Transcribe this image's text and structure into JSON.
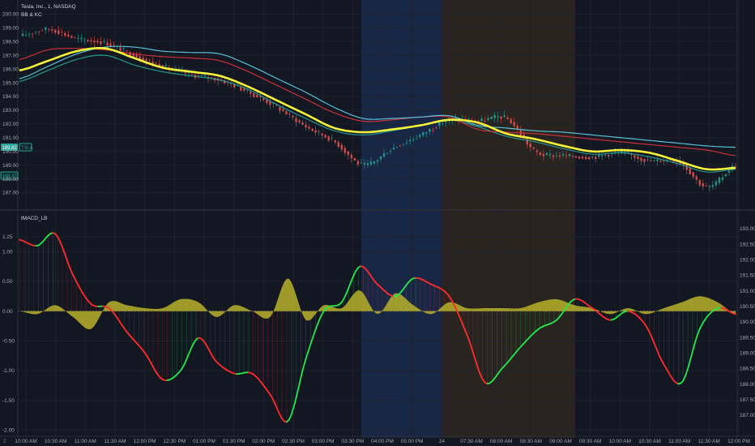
{
  "header": {
    "symbol_title": "Tesla, Inc., 1, NASDAQ",
    "indicator_1": "BB & KC",
    "indicator_2": "tMACD_LB",
    "corner_label": "Z"
  },
  "price_badges": {
    "last_price": "189.82",
    "ticker": "TSLA",
    "secondary": "188.37"
  },
  "colors": {
    "background": "#131722",
    "grid": "#1e222d",
    "session_blue": "#1b2a4d",
    "session_brown": "#2c2620",
    "kc_yellow": "#f5f23a",
    "bb_cyan": "#5cc8e0",
    "kc_red": "#d2323c",
    "candle_up": "#26a69a",
    "candle_down": "#ef5350",
    "macd_up": "#22e84a",
    "macd_down": "#ff2b2b",
    "hist_olive": "#b7b02a"
  },
  "chart_data": [
    {
      "type": "line",
      "title": "Tesla, Inc., 1, NASDAQ",
      "subtitle": "BB & KC",
      "ylim": [
        186.5,
        200.2
      ],
      "yticks": [
        "200.00",
        "199.00",
        "198.00",
        "197.00",
        "196.00",
        "195.00",
        "194.00",
        "193.00",
        "192.00",
        "191.00",
        "190.00",
        "189.00",
        "188.00",
        "187.00"
      ],
      "ytick_values": [
        200,
        199,
        198,
        197,
        196,
        195,
        194,
        193,
        192,
        191,
        190,
        189,
        188,
        187
      ],
      "x_labels": [
        "10:00 AM",
        "10:30 AM",
        "11:00 AM",
        "11:30 AM",
        "12:00 PM",
        "12:30 PM",
        "01:00 PM",
        "01:30 PM",
        "02:00 PM",
        "02:30 PM",
        "03:00 PM",
        "03:30 PM",
        "04:00 PM",
        "05:00 PM",
        "24",
        "07:30 AM",
        "08:00 AM",
        "08:30 AM",
        "09:00 AM",
        "09:30 AM",
        "10:00 AM",
        "10:30 AM",
        "11:00 AM",
        "11:30 AM",
        "12:00 PM"
      ],
      "x": [
        0,
        4,
        8,
        12,
        16,
        20,
        24,
        28,
        32,
        36,
        40,
        44,
        48,
        52,
        56,
        60,
        64,
        68,
        72,
        76,
        80,
        84,
        88,
        92,
        96,
        100
      ],
      "series": [
        {
          "key": "price",
          "values": [
            198.4,
            198.9,
            198.2,
            197.9,
            197.0,
            196.2,
            195.6,
            195.2,
            194.3,
            193.2,
            191.8,
            190.7,
            189.0,
            190.2,
            191.2,
            192.3,
            192.2,
            192.4,
            190.0,
            189.7,
            189.6,
            189.9,
            189.3,
            189.3,
            187.4,
            189.0
          ]
        },
        {
          "key": "kc_basis",
          "values": [
            195.9,
            196.6,
            197.3,
            197.5,
            196.8,
            196.1,
            195.8,
            195.5,
            194.7,
            193.7,
            192.7,
            191.7,
            191.4,
            191.6,
            191.9,
            192.3,
            192.1,
            191.3,
            190.9,
            190.4,
            190.0,
            190.1,
            189.9,
            189.3,
            188.7,
            188.8
          ]
        },
        {
          "key": "kc_upper",
          "values": [
            196.7,
            197.4,
            197.5,
            197.4,
            197.1,
            196.9,
            196.8,
            196.6,
            195.8,
            194.8,
            193.8,
            192.8,
            192.2,
            192.3,
            192.5,
            192.5,
            191.6,
            191.4,
            191.3,
            191.1,
            190.9,
            190.7,
            190.5,
            190.3,
            190.1,
            189.7
          ]
        },
        {
          "key": "bb_upper",
          "values": [
            195.3,
            196.2,
            197.1,
            197.6,
            197.6,
            197.3,
            197.2,
            197.1,
            196.3,
            195.3,
            194.3,
            193.2,
            192.4,
            192.4,
            192.5,
            192.6,
            191.9,
            191.7,
            191.5,
            191.4,
            191.2,
            191.0,
            190.8,
            190.6,
            190.4,
            190.3
          ]
        },
        {
          "key": "bb_lower",
          "values": [
            195.1,
            195.9,
            196.7,
            197.0,
            196.3,
            195.8,
            195.5,
            195.2,
            194.5,
            193.4,
            192.4,
            191.5,
            191.2,
            191.5,
            191.9,
            192.3,
            191.8,
            191.1,
            190.7,
            190.2,
            189.8,
            189.9,
            189.6,
            189.1,
            188.5,
            188.7
          ]
        }
      ]
    },
    {
      "type": "line",
      "title": "tMACD_LB",
      "ylim": [
        -2.05,
        1.55
      ],
      "yticks": [
        "1.25",
        "1.00",
        "0.50",
        "0.00",
        "-0.50",
        "-1.00",
        "-1.50",
        "-2.00"
      ],
      "ytick_values": [
        1.25,
        1.0,
        0.5,
        0.0,
        -0.5,
        -1.0,
        -1.5,
        -2.0
      ],
      "right_yticks": [
        "193.00",
        "192.50",
        "192.00",
        "191.50",
        "191.00",
        "190.50",
        "190.00",
        "189.50",
        "189.00",
        "188.50",
        "188.00",
        "187.50",
        "187.00"
      ],
      "x": [
        0,
        2.5,
        5,
        7.5,
        10,
        12.5,
        15,
        17.5,
        20,
        22.5,
        25,
        27.5,
        30,
        32.5,
        35,
        37.5,
        40,
        42.5,
        45,
        47.5,
        50,
        52.5,
        55,
        57.5,
        60,
        62.5,
        65,
        67.5,
        70,
        72.5,
        75,
        77.5,
        80,
        82.5,
        85,
        87.5,
        90,
        92.5,
        95,
        97.5,
        100
      ],
      "series": [
        {
          "key": "macd",
          "values": [
            1.2,
            1.1,
            1.3,
            0.6,
            0.12,
            0.05,
            -0.35,
            -0.7,
            -1.15,
            -1.0,
            -0.45,
            -0.85,
            -1.05,
            -1.05,
            -1.4,
            -1.85,
            -0.8,
            0.0,
            0.15,
            0.75,
            0.45,
            0.25,
            0.55,
            0.45,
            0.25,
            -0.4,
            -1.2,
            -0.95,
            -0.6,
            -0.3,
            -0.15,
            0.2,
            0.05,
            -0.15,
            0.0,
            -0.25,
            -0.9,
            -1.2,
            -0.3,
            0.05,
            -0.05
          ]
        },
        {
          "key": "histogram",
          "values": [
            0.0,
            -0.05,
            0.1,
            -0.1,
            -0.3,
            0.15,
            0.1,
            0.05,
            0.05,
            0.2,
            0.15,
            -0.1,
            0.1,
            0.0,
            -0.1,
            0.55,
            -0.15,
            0.1,
            0.05,
            0.35,
            -0.05,
            0.3,
            0.1,
            -0.05,
            0.15,
            0.05,
            0.05,
            0.05,
            0.05,
            0.15,
            0.2,
            0.1,
            0.05,
            -0.05,
            0.05,
            -0.05,
            0.05,
            0.15,
            0.25,
            0.15,
            -0.05
          ]
        }
      ]
    }
  ]
}
